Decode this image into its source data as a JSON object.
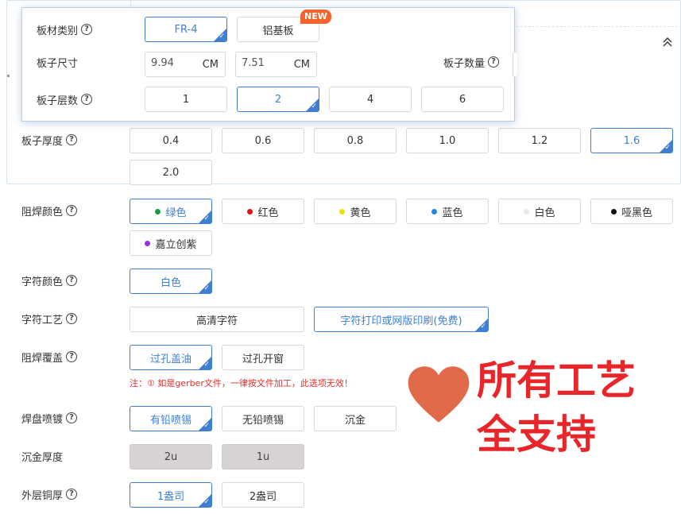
{
  "popup": {
    "board_type": {
      "label": "板材类别",
      "options": [
        {
          "label": "FR-4",
          "selected": true
        },
        {
          "label": "铝基板",
          "selected": false
        }
      ],
      "new_badge": "NEW"
    },
    "board_size": {
      "label": "板子尺寸",
      "width": "9.94",
      "height": "7.51",
      "unit": "CM"
    },
    "board_qty": {
      "label": "板子数量"
    },
    "layers": {
      "label": "板子层数",
      "options": [
        "1",
        "2",
        "4",
        "6"
      ],
      "selected": "2"
    }
  },
  "thickness": {
    "label": "板子厚度",
    "options": [
      "0.4",
      "0.6",
      "0.8",
      "1.0",
      "1.2",
      "1.6",
      "2.0"
    ],
    "selected": "1.6"
  },
  "solder_mask": {
    "label": "阻焊颜色",
    "options": [
      {
        "label": "绿色",
        "color": "#1a9a3c"
      },
      {
        "label": "红色",
        "color": "#e01010"
      },
      {
        "label": "黄色",
        "color": "#f2e100"
      },
      {
        "label": "蓝色",
        "color": "#1e88e5"
      },
      {
        "label": "白色",
        "color": "#e8e8e8"
      },
      {
        "label": "哑黑色",
        "color": "#111111"
      },
      {
        "label": "嘉立创紫",
        "color": "#9b30e0"
      }
    ],
    "selected": "绿色"
  },
  "silk_color": {
    "label": "字符颜色",
    "options": [
      "白色"
    ],
    "selected": "白色"
  },
  "silk_process": {
    "label": "字符工艺",
    "options": [
      "高清字符",
      "字符打印或网版印刷(免费)"
    ],
    "selected": "字符打印或网版印刷(免费)"
  },
  "via_cover": {
    "label": "阻焊覆盖",
    "options": [
      "过孔盖油",
      "过孔开窗"
    ],
    "selected": "过孔盖油",
    "note": "注：① 如是gerber文件，一律按文件加工，此选项无效！"
  },
  "surface": {
    "label": "焊盘喷镀",
    "options": [
      "有铅喷锡",
      "无铅喷锡",
      "沉金"
    ],
    "selected": "有铅喷锡"
  },
  "gold_thickness": {
    "label": "沉金厚度",
    "options": [
      "2u",
      "1u"
    ]
  },
  "copper": {
    "label": "外层铜厚",
    "options": [
      "1盎司",
      "2盎司"
    ],
    "selected": "1盎司"
  },
  "promo": {
    "line1": "所有工艺",
    "line2": "全支持",
    "heart_color": "#e06a4a"
  },
  "icons": {
    "help": "?",
    "check": "✓",
    "collapse": "chevrons-up"
  }
}
